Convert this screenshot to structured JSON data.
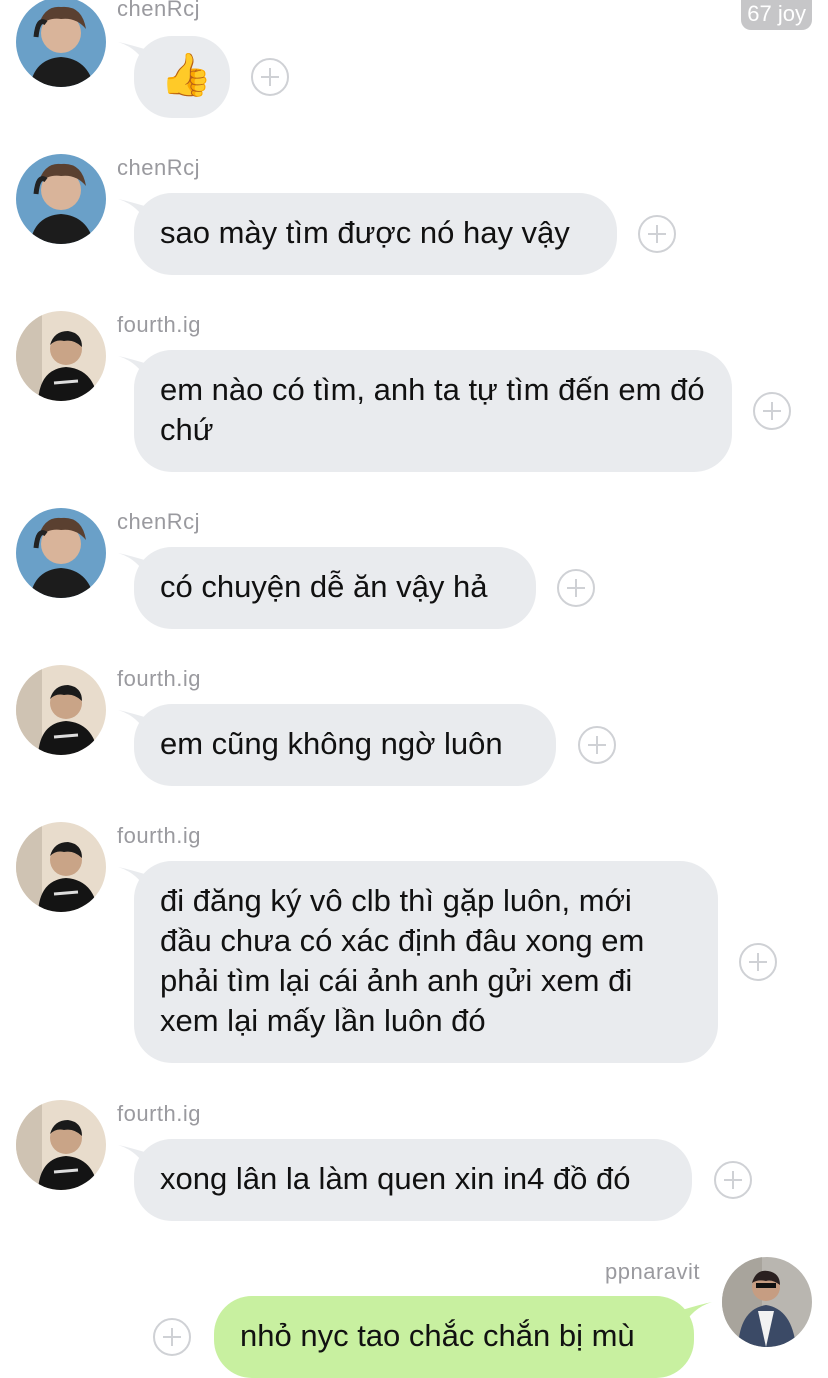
{
  "badge": "67 joy",
  "messages": [
    {
      "sender": "chenRcj",
      "text": "👍",
      "side": "in",
      "avatar": "chen"
    },
    {
      "sender": "chenRcj",
      "text": "sao mày tìm được nó hay vậy",
      "side": "in",
      "avatar": "chen"
    },
    {
      "sender": "fourth.ig",
      "text": "em nào có tìm, anh ta tự tìm đến em đó chứ",
      "side": "in",
      "avatar": "fourth"
    },
    {
      "sender": "chenRcj",
      "text": "có chuyện dễ ăn vậy hả",
      "side": "in",
      "avatar": "chen"
    },
    {
      "sender": "fourth.ig",
      "text": "em cũng không ngờ luôn",
      "side": "in",
      "avatar": "fourth"
    },
    {
      "sender": "fourth.ig",
      "text": "đi đăng ký vô clb thì gặp luôn, mới đầu chưa có xác định đâu xong em phải tìm lại cái ảnh anh gửi xem đi xem lại mấy lần luôn đó",
      "side": "in",
      "avatar": "fourth"
    },
    {
      "sender": "fourth.ig",
      "text": "xong lân la làm quen xin in4 đồ đó",
      "side": "in",
      "avatar": "fourth"
    },
    {
      "sender": "ppnaravit",
      "text": "nhỏ nyc tao chắc chắn bị mù",
      "side": "out",
      "avatar": "ppn"
    }
  ],
  "colors": {
    "incoming_bubble": "#e9ebee",
    "outgoing_bubble": "#c8f0a0",
    "sender_text": "#9a9a9f",
    "plus_icon": "#cfd1d5"
  }
}
